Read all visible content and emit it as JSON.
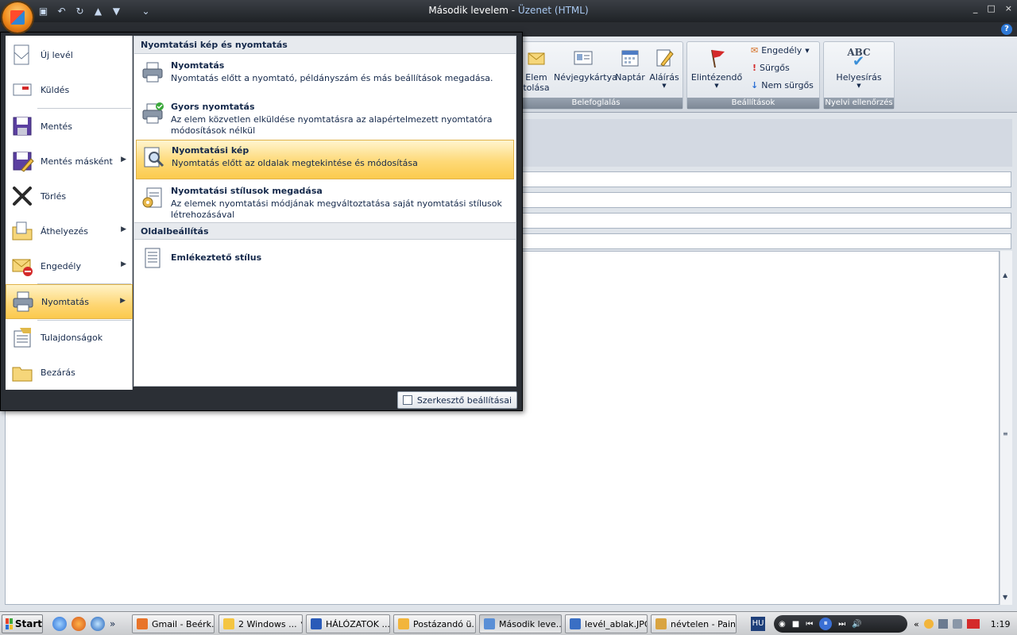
{
  "window": {
    "title": "Második levelem",
    "title_sep": " - ",
    "subtitle": "Üzenet (HTML)",
    "controls": [
      "_",
      "□",
      "×"
    ]
  },
  "help_label": "?",
  "ribbon": {
    "insert_group": {
      "label": "Belefoglalás",
      "buttons": [
        {
          "label1": "Elem",
          "label2": "tolása",
          "icon": "attach-item-icon"
        },
        {
          "label": "Névjegykártya",
          "icon": "business-card-icon"
        },
        {
          "label": "Naptár",
          "icon": "calendar-icon"
        },
        {
          "label": "Aláírás",
          "icon": "signature-icon"
        }
      ]
    },
    "options_group": {
      "label": "Beállítások",
      "followup": "Elintézendő",
      "permission": "Engedély",
      "high": "Sürgős",
      "low": "Nem sürgős"
    },
    "proofing_group": {
      "label": "Nyelvi ellenőrzés",
      "spelling": "Helyesírás",
      "abc": "ABC"
    }
  },
  "office_menu": {
    "left_items": [
      {
        "label": "Új levél",
        "icon": "new-mail-icon",
        "arrow": false
      },
      {
        "label": "Küldés",
        "icon": "send-icon",
        "arrow": false
      },
      {
        "label": "Mentés",
        "icon": "save-icon",
        "arrow": false
      },
      {
        "label": "Mentés másként",
        "icon": "save-as-icon",
        "arrow": true
      },
      {
        "label": "Törlés",
        "icon": "delete-icon",
        "arrow": false
      },
      {
        "label": "Áthelyezés",
        "icon": "move-icon",
        "arrow": true
      },
      {
        "label": "Engedély",
        "icon": "permission-icon",
        "arrow": true
      },
      {
        "label": "Nyomtatás",
        "icon": "print-icon",
        "arrow": true,
        "active": true
      },
      {
        "label": "Tulajdonságok",
        "icon": "properties-icon",
        "arrow": false
      },
      {
        "label": "Bezárás",
        "icon": "close-folder-icon",
        "arrow": false
      }
    ],
    "right": {
      "section1": "Nyomtatási kép és nyomtatás",
      "items": [
        {
          "title": "Nyomtatás",
          "desc": "Nyomtatás előtt a nyomtató, példányszám és más beállítások megadása.",
          "icon": "printer-icon"
        },
        {
          "title": "Gyors nyomtatás",
          "desc": "Az elem közvetlen  elküldése nyomtatásra az alapértelmezett nyomtatóra módosítások nélkül",
          "icon": "quick-print-icon"
        },
        {
          "title": "Nyomtatási kép",
          "desc": "Nyomtatás előtt az oldalak megtekintése és módosítása",
          "icon": "print-preview-icon",
          "active": true
        },
        {
          "title": "Nyomtatási stílusok megadása",
          "desc": "Az elemek nyomtatási módjának megváltoztatása saját nyomtatási stílusok létrehozásával",
          "icon": "print-styles-icon"
        }
      ],
      "section2": "Oldalbeállítás",
      "page_item": {
        "title": "Emlékeztető stílus",
        "icon": "memo-style-icon"
      }
    },
    "editor_options": "Szerkesztő beállításai"
  },
  "taskbar": {
    "start": "Start",
    "more": "»",
    "buttons": [
      {
        "label": "Gmail - Beérk...",
        "color": "#e8742a"
      },
      {
        "label": "2 Windows ...",
        "color": "#f4c542",
        "dropdown": true
      },
      {
        "label": "HÁLÓZATOK ...",
        "color": "#2a5bb8"
      },
      {
        "label": "Postázandó ü...",
        "color": "#f2b53c"
      },
      {
        "label": "Második leve...",
        "color": "#5a8fd6",
        "active": true
      },
      {
        "label": "levél_ablak.JPG",
        "color": "#3a6fc4"
      },
      {
        "label": "névtelen - Paint",
        "color": "#d9a441"
      }
    ],
    "lang": "HU",
    "clock": "1:19",
    "tray_chev": "«"
  }
}
